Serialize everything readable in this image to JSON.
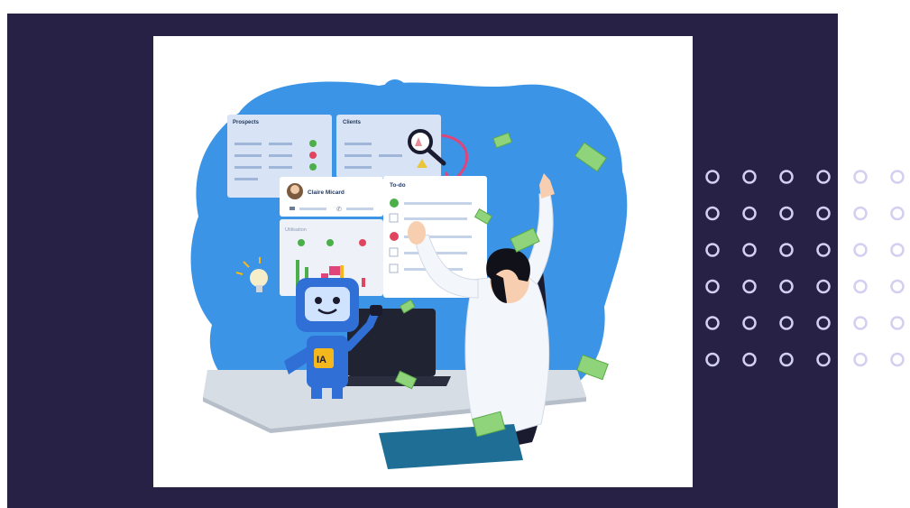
{
  "illustration": {
    "prospects_title": "Prospects",
    "clients_title": "Clients",
    "contact_name": "Claire Micard",
    "todo_title": "To-do",
    "utilisation_label": "Utilisation",
    "robot_badge": "IA"
  },
  "colors": {
    "background": "#262145",
    "blob": "#3b94e6",
    "robot": "#2f6fd6",
    "badge": "#f5b81c",
    "money": "#8fd47a",
    "check": "#4cb04a",
    "cross": "#e0455f",
    "arrow": "#e0457a",
    "dots": "#d3cff0"
  },
  "icons": [
    "magnifier-icon",
    "lightbulb-icon",
    "check-icon",
    "cross-icon",
    "warning-icon",
    "mail-icon",
    "phone-icon"
  ],
  "decor": {
    "dot_rows": 6,
    "dot_cols": 6
  }
}
